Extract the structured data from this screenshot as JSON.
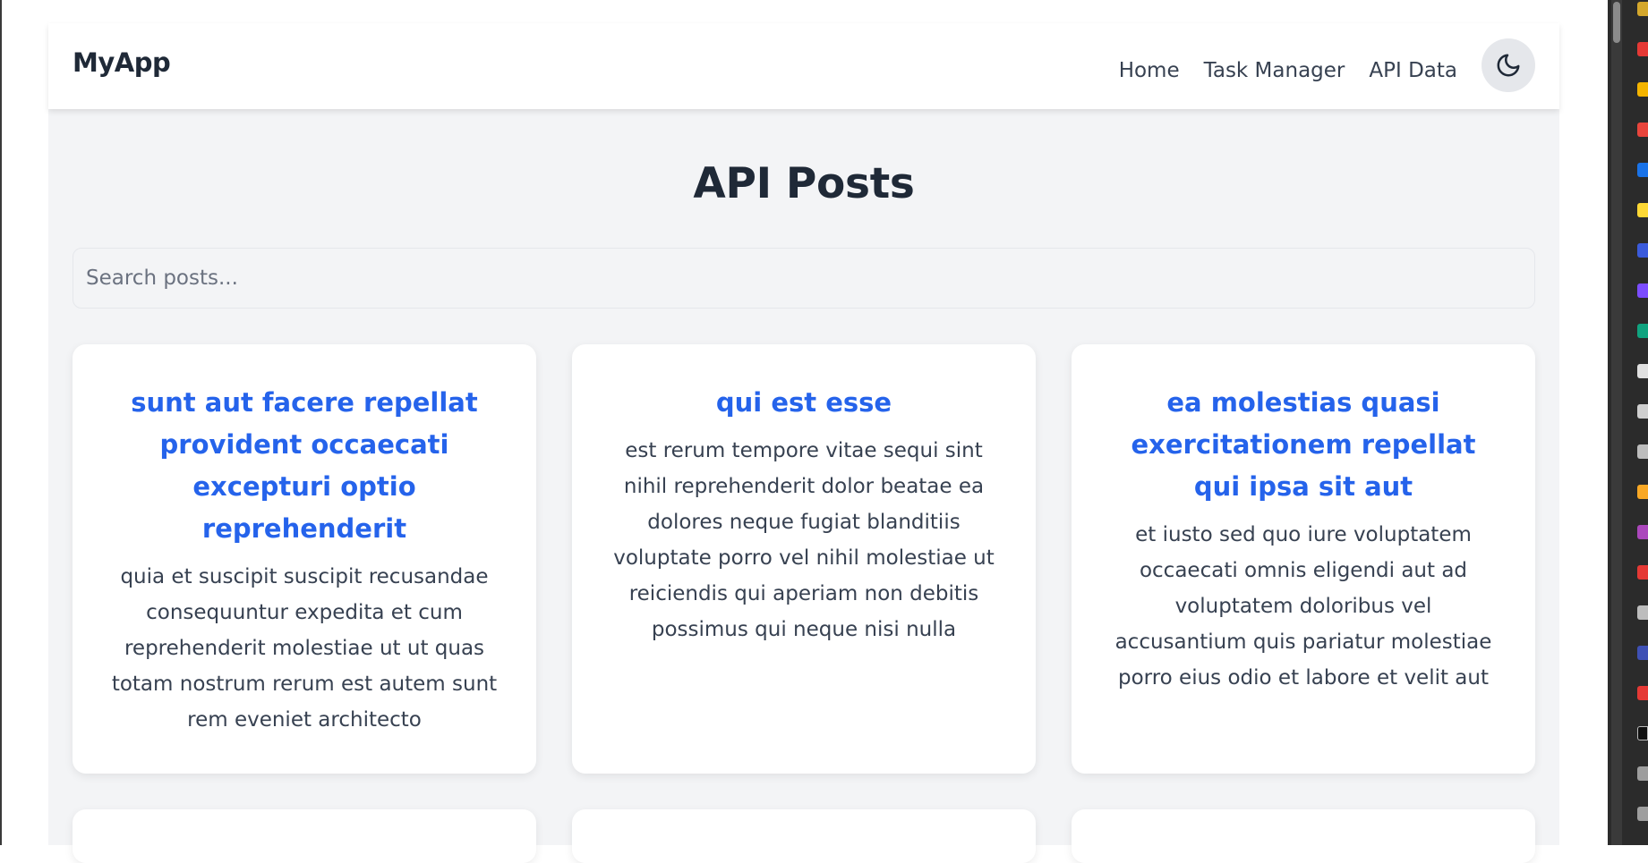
{
  "navbar": {
    "brand": "MyApp",
    "links": [
      "Home",
      "Task Manager",
      "API Data"
    ],
    "theme_icon": "moon-icon"
  },
  "main": {
    "title": "API Posts",
    "search": {
      "placeholder": "Search posts...",
      "value": ""
    },
    "posts": [
      {
        "title": "sunt aut facere repellat provident occaecati excepturi optio reprehenderit",
        "body": "quia et suscipit suscipit recusandae consequuntur expedita et cum reprehenderit molestiae ut ut quas totam nostrum rerum est autem sunt rem eveniet architecto"
      },
      {
        "title": "qui est esse",
        "body": "est rerum tempore vitae sequi sint nihil reprehenderit dolor beatae ea dolores neque fugiat blanditiis voluptate porro vel nihil molestiae ut reiciendis qui aperiam non debitis possimus qui neque nisi nulla"
      },
      {
        "title": "ea molestias quasi exercitationem repellat qui ipsa sit aut",
        "body": "et iusto sed quo iure voluptatem occaecati omnis eligendi aut ad voluptatem doloribus vel accusantium quis pariatur molestiae porro eius odio et labore et velit aut"
      }
    ]
  },
  "colors": {
    "accent": "#2563eb",
    "page_bg": "#f3f4f6",
    "card_bg": "#ffffff",
    "text": "#1f2937"
  }
}
